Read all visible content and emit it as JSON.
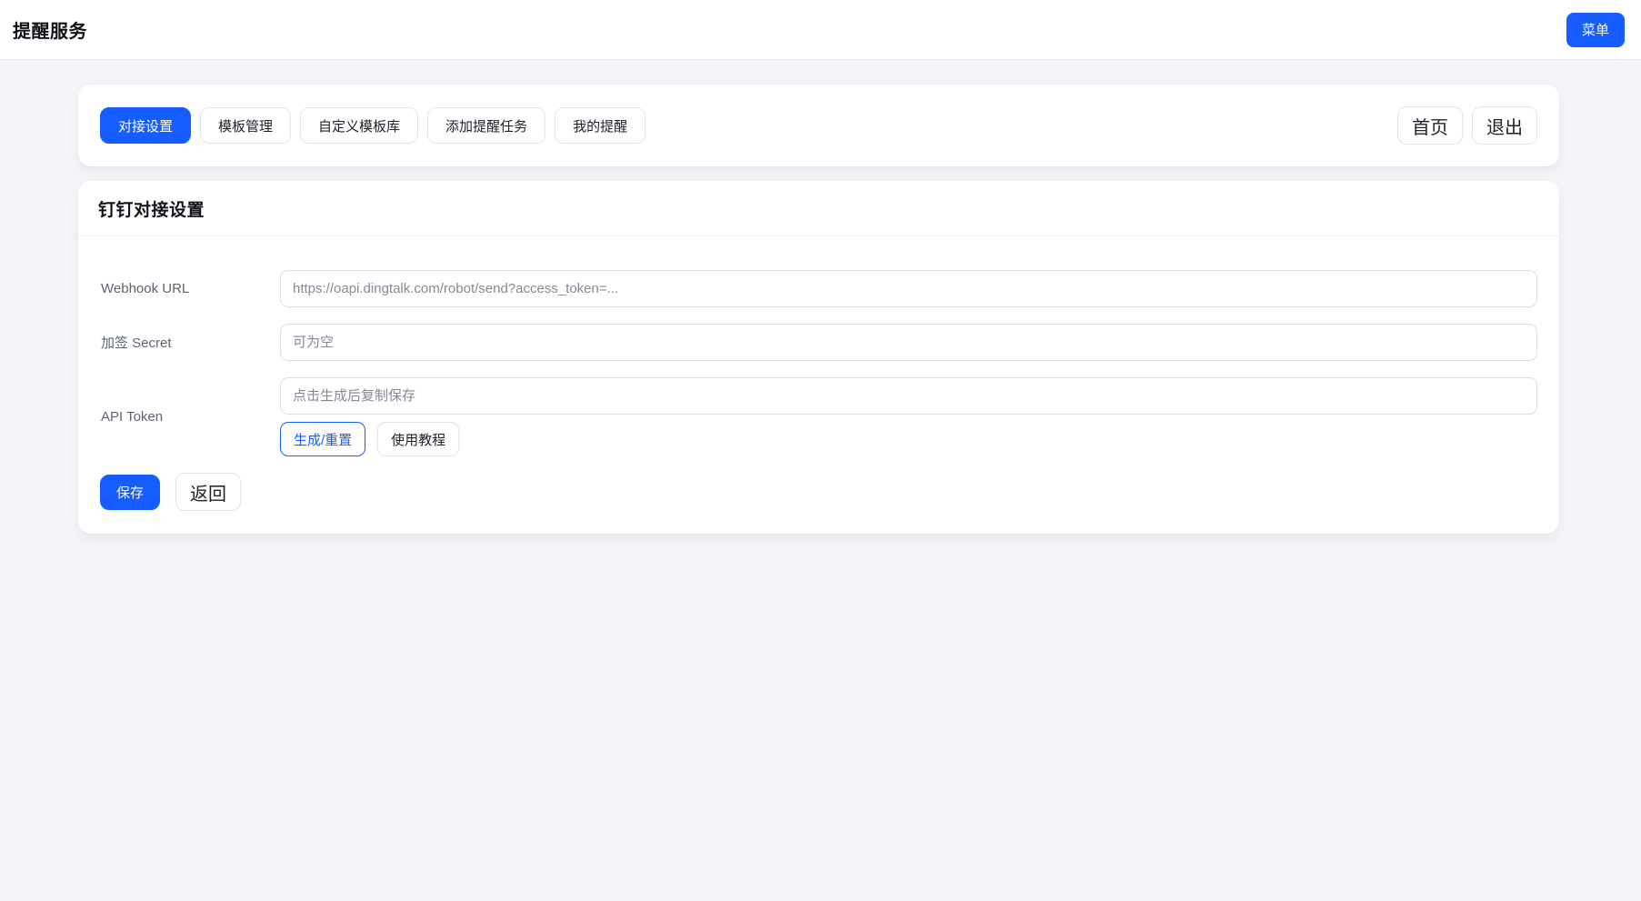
{
  "header": {
    "title": "提醒服务",
    "menu_button": "菜单"
  },
  "nav": {
    "tabs": [
      {
        "label": "对接设置",
        "active": true
      },
      {
        "label": "模板管理",
        "active": false
      },
      {
        "label": "自定义模板库",
        "active": false
      },
      {
        "label": "添加提醒任务",
        "active": false
      },
      {
        "label": "我的提醒",
        "active": false
      }
    ],
    "home_button": "首页",
    "logout_button": "退出"
  },
  "settings": {
    "title": "钉钉对接设置",
    "fields": {
      "webhook": {
        "label": "Webhook URL",
        "value": "",
        "placeholder": "https://oapi.dingtalk.com/robot/send?access_token=..."
      },
      "secret": {
        "label": "加签 Secret",
        "value": "",
        "placeholder": "可为空"
      },
      "token": {
        "label": "API Token",
        "value": "",
        "placeholder": "点击生成后复制保存"
      }
    },
    "generate_button": "生成/重置",
    "tutorial_button": "使用教程",
    "save_button": "保存",
    "back_button": "返回"
  },
  "colors": {
    "primary": "#165dff",
    "page_background": "#f4f5f9",
    "card_background": "#ffffff"
  }
}
